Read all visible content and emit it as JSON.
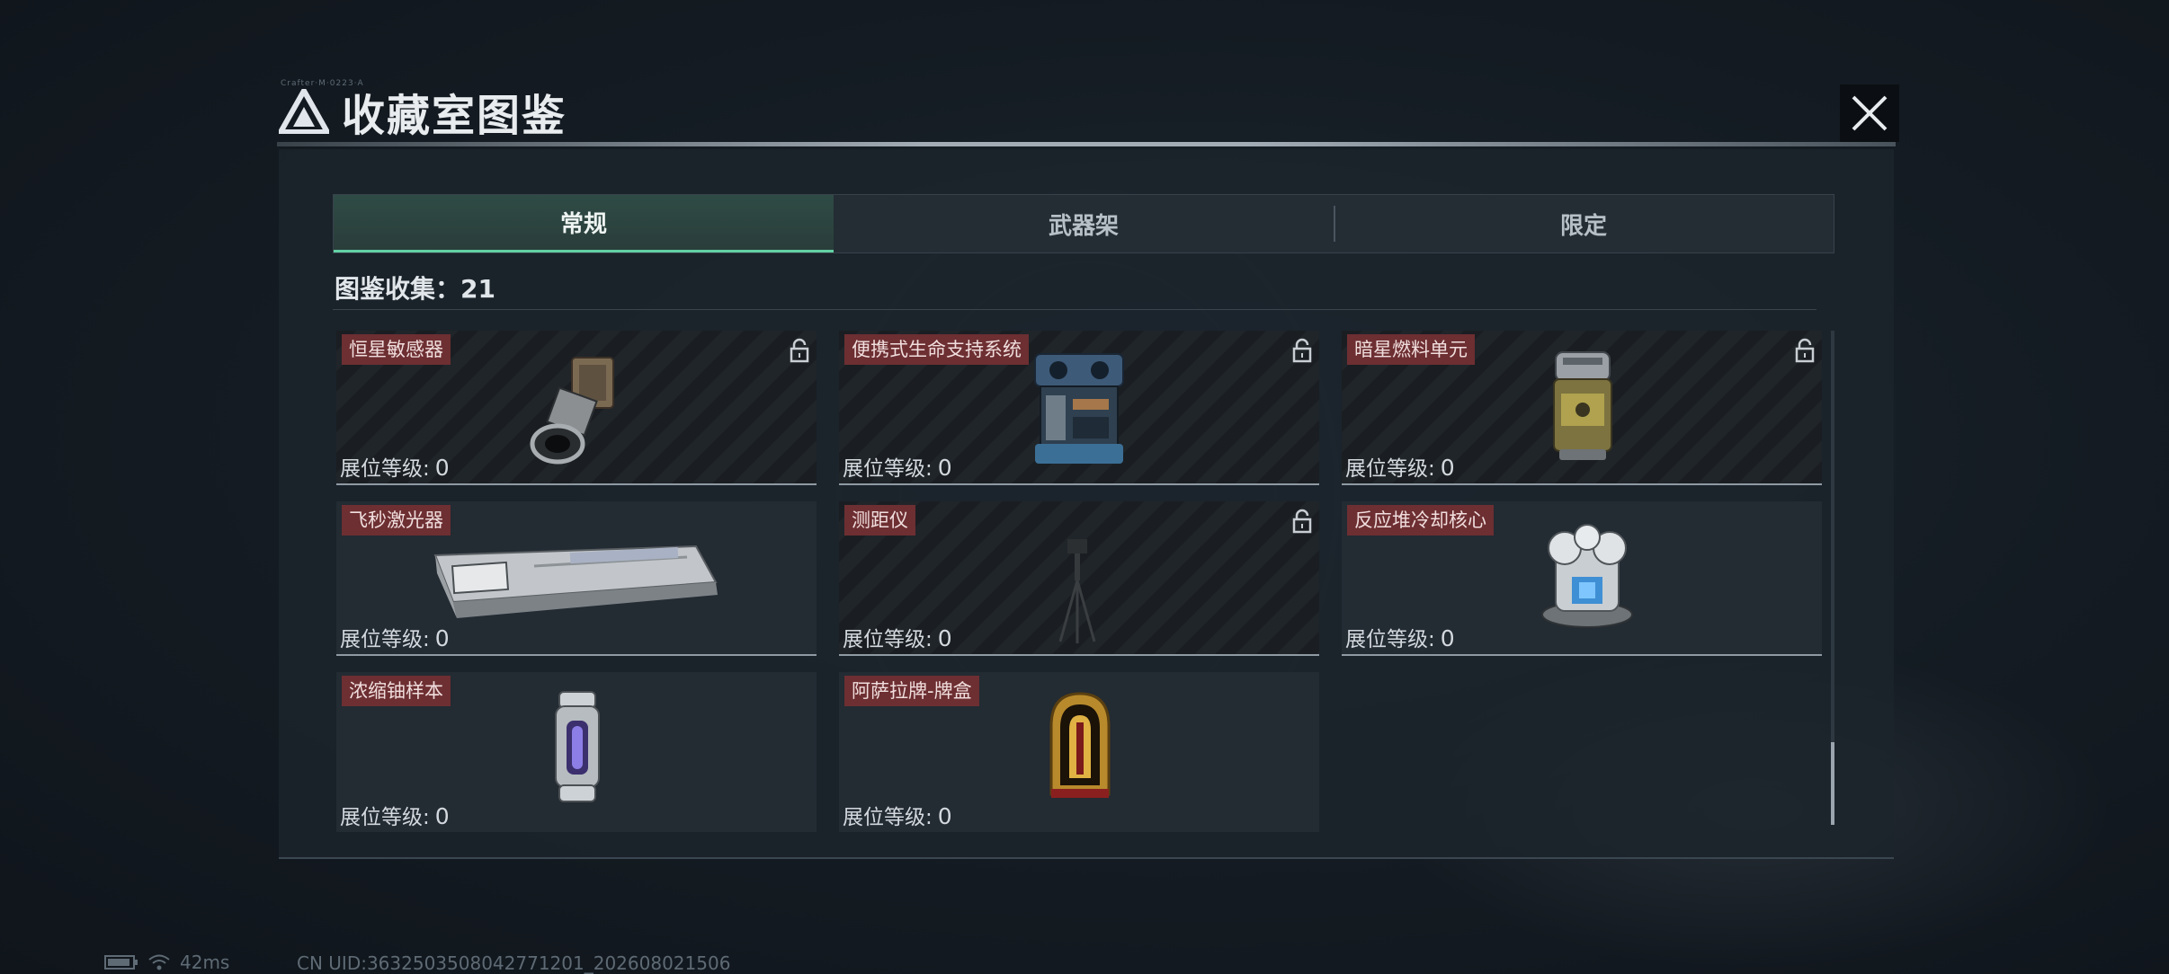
{
  "window": {
    "title": "收藏室图鉴",
    "subtitle_mini": "Crafter·M·0223·A"
  },
  "tabs": [
    {
      "label": "常规",
      "active": true
    },
    {
      "label": "武器架",
      "active": false
    },
    {
      "label": "限定",
      "active": false
    }
  ],
  "collection": {
    "label": "图鉴收集：",
    "count": "21"
  },
  "items": [
    {
      "name": "恒星敏感器",
      "level_label": "展位等级:",
      "level": "0",
      "locked": true,
      "icon": "star-sensor-icon"
    },
    {
      "name": "便携式生命支持系统",
      "level_label": "展位等级:",
      "level": "0",
      "locked": true,
      "icon": "life-support-icon"
    },
    {
      "name": "暗星燃料单元",
      "level_label": "展位等级:",
      "level": "0",
      "locked": true,
      "icon": "fuel-cell-icon"
    },
    {
      "name": "飞秒激光器",
      "level_label": "展位等级:",
      "level": "0",
      "locked": false,
      "icon": "femtosecond-laser-icon"
    },
    {
      "name": "测距仪",
      "level_label": "展位等级:",
      "level": "0",
      "locked": true,
      "icon": "rangefinder-icon"
    },
    {
      "name": "反应堆冷却核心",
      "level_label": "展位等级:",
      "level": "0",
      "locked": false,
      "icon": "reactor-core-icon"
    },
    {
      "name": "浓缩铀样本",
      "level_label": "展位等级:",
      "level": "0",
      "locked": false,
      "icon": "uranium-sample-icon"
    },
    {
      "name": "阿萨拉牌-牌盒",
      "level_label": "展位等级:",
      "level": "0",
      "locked": false,
      "icon": "card-box-icon"
    }
  ],
  "status": {
    "ping": "42ms",
    "uid": "CN UID:3632503508042771201_202608021506"
  },
  "colors": {
    "accent": "#62d0a4",
    "name_badge": "#6d2f32",
    "panel": "#1c242c"
  }
}
